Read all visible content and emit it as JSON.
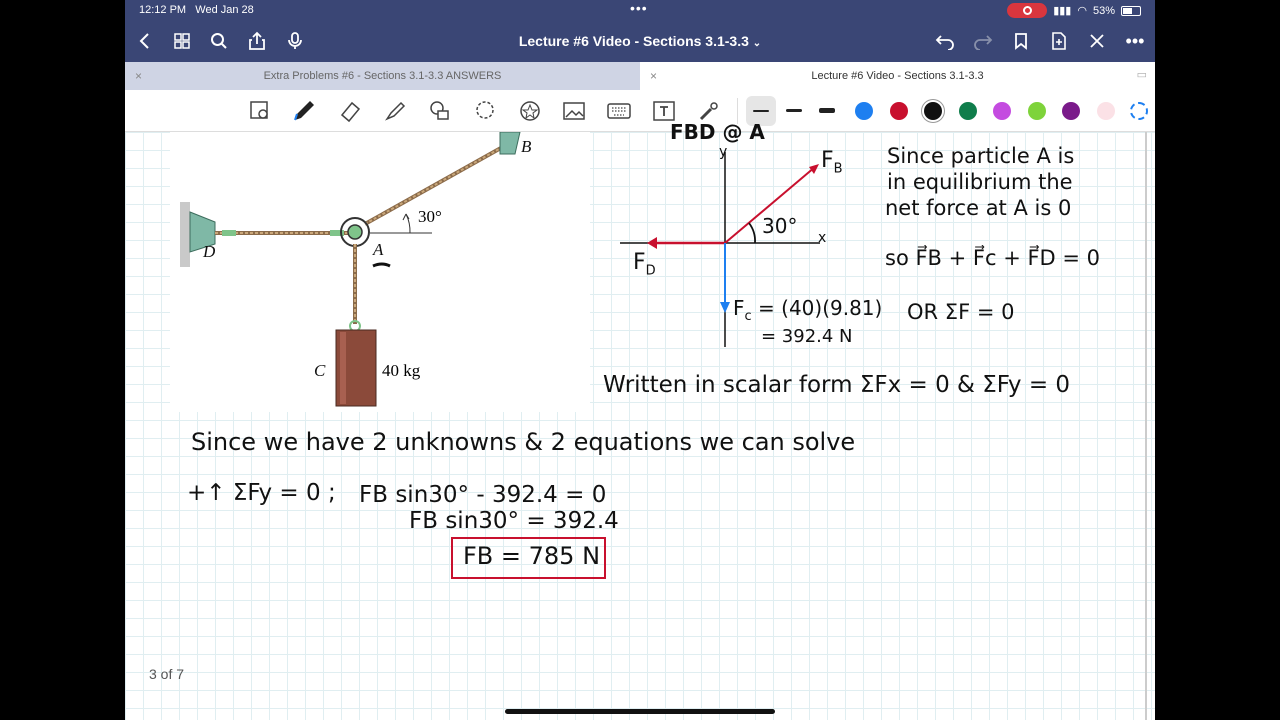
{
  "status": {
    "time": "12:12 PM",
    "date": "Wed Jan 28",
    "battery": "53%"
  },
  "nav": {
    "title": "Lecture #6 Video - Sections 3.1-3.3"
  },
  "tabs": [
    {
      "label": "Extra Problems #6 - Sections 3.1-3.3 ANSWERS",
      "active": false
    },
    {
      "label": "Lecture #6 Video - Sections 3.1-3.3",
      "active": true
    }
  ],
  "toolbar": {
    "tools": [
      "lasso-select-icon",
      "pen-icon",
      "eraser-icon",
      "highlighter-icon",
      "shapes-icon",
      "lasso-icon",
      "sticker-icon",
      "image-icon",
      "keyboard-icon",
      "text-box-icon",
      "laser-pointer-icon"
    ],
    "colors": [
      "#1e7ff0",
      "#c8102e",
      "#111111",
      "#0f7d4b",
      "#c44be0",
      "#7ed33a",
      "#7a1a8a",
      "#fbe1e6"
    ]
  },
  "figure": {
    "label_b": "B",
    "label_d": "D",
    "label_a": "A",
    "label_c": "C",
    "angle": "30°",
    "mass": "40 kg"
  },
  "notes": {
    "fbd_header": "FBD @ A",
    "fb": "F",
    "fb_sub": "B",
    "fd": "F",
    "fd_sub": "D",
    "fbd_angle": "30°",
    "axis_x": "x",
    "axis_y": "y",
    "fc_line1": "F",
    "fc_sub": "c",
    "fc_eq": "= (40)(9.81)",
    "fc_line2": "= 392.4 N",
    "since_1": "Since particle A is",
    "since_2": "in equilibrium the",
    "since_3": "net force at A is 0",
    "vec_eq": "so F⃗B + F⃗c + F⃗D = 0",
    "or_eq": "OR  ΣF = 0",
    "scalar": "Written in scalar form  ΣFx = 0 & ΣFy = 0",
    "unknowns": "Since we have 2 unknowns & 2 equations we can solve",
    "sum_y": "+↑ ΣFy = 0 ;",
    "eq1": "FB sin30° - 392.4 = 0",
    "eq2": "FB sin30° = 392.4",
    "answer": "FB = 785 N"
  },
  "page": {
    "indicator": "3 of 7"
  }
}
